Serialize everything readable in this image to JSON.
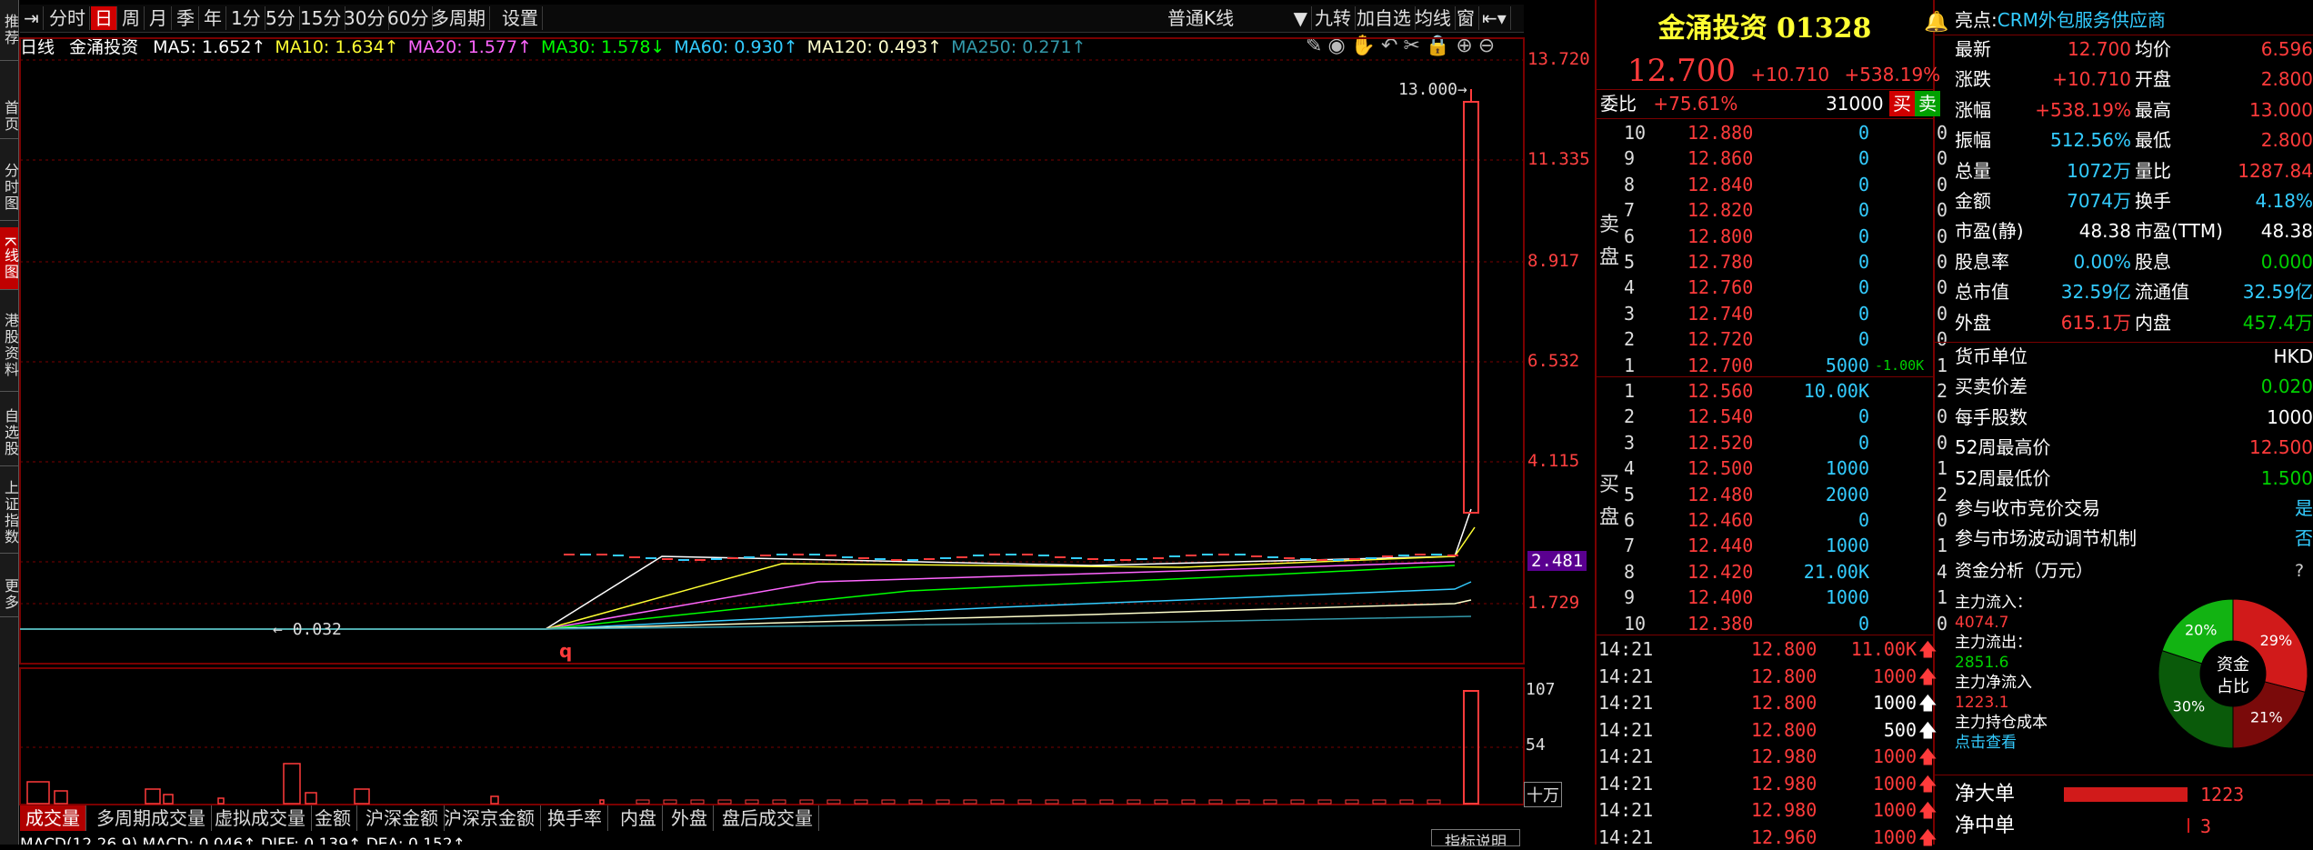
{
  "leftnav": [
    "推荐",
    "首页",
    "分时图",
    "K线图",
    "港股资料",
    "自选股",
    "上证指数",
    "更多"
  ],
  "toolbar": {
    "items": [
      "分时",
      "日",
      "周",
      "月",
      "季",
      "年",
      "1分",
      "5分",
      "15分",
      "30分",
      "60分",
      "多周期",
      "设置"
    ],
    "active": "日",
    "kline_type": "普通K线",
    "right_items": [
      "九转",
      "加自选",
      "均线",
      "窗"
    ]
  },
  "ma_legend": {
    "period": "日线",
    "name": "金涌投资",
    "items": [
      {
        "label": "MA5: 1.652↑",
        "color": "#ffffff"
      },
      {
        "label": "MA10: 1.634↑",
        "color": "#ffff33"
      },
      {
        "label": "MA20: 1.577↑",
        "color": "#ff66ff"
      },
      {
        "label": "MA30: 1.578↓",
        "color": "#00ff00"
      },
      {
        "label": "MA60: 0.930↑",
        "color": "#33ccff"
      },
      {
        "label": "MA120: 0.493↑",
        "color": "#ffffcc"
      },
      {
        "label": "MA250: 0.271↑",
        "color": "#3399aa"
      }
    ]
  },
  "price_axis": [
    "13.720",
    "11.335",
    "8.917",
    "6.532",
    "4.115",
    "2.481",
    "1.729"
  ],
  "annotations": {
    "high": "13.000",
    "low": "0.032",
    "marker": "q"
  },
  "volume_axis": [
    "107",
    "54",
    "十万"
  ],
  "bottom_tabs": [
    "成交量",
    "多周期成交量",
    "虚拟成交量",
    "金额",
    "沪深金额",
    "沪深京金额",
    "换手率",
    "内盘",
    "外盘",
    "盘后成交量"
  ],
  "macd_line": "MACD(12,26,9)  MACD: 0.046↑  DIFF: 0.139↑  DEA: 0.152↑",
  "indicator_btn": "指标说明",
  "stock": {
    "name": "金涌投资 01328",
    "price": "12.700",
    "change": "+10.710",
    "change_pct": "+538.19%"
  },
  "weibi": {
    "label": "委比",
    "value": "+75.61%",
    "amount": "31000",
    "buy": "买",
    "sell": "卖"
  },
  "sell_side_label": "卖盘",
  "buy_side_label": "买盘",
  "sell_orders": [
    {
      "level": "10",
      "price": "12.880",
      "vol": "0",
      "cnt": "0"
    },
    {
      "level": "9",
      "price": "12.860",
      "vol": "0",
      "cnt": "0"
    },
    {
      "level": "8",
      "price": "12.840",
      "vol": "0",
      "cnt": "0"
    },
    {
      "level": "7",
      "price": "12.820",
      "vol": "0",
      "cnt": "0"
    },
    {
      "level": "6",
      "price": "12.800",
      "vol": "0",
      "cnt": "0"
    },
    {
      "level": "5",
      "price": "12.780",
      "vol": "0",
      "cnt": "0"
    },
    {
      "level": "4",
      "price": "12.760",
      "vol": "0",
      "cnt": "0"
    },
    {
      "level": "3",
      "price": "12.740",
      "vol": "0",
      "cnt": "0"
    },
    {
      "level": "2",
      "price": "12.720",
      "vol": "0",
      "cnt": "0"
    },
    {
      "level": "1",
      "price": "12.700",
      "vol": "5000",
      "extra": "-1.00K",
      "cnt": "1"
    }
  ],
  "buy_orders": [
    {
      "level": "1",
      "price": "12.560",
      "vol": "10.00K",
      "cnt": "2"
    },
    {
      "level": "2",
      "price": "12.540",
      "vol": "0",
      "cnt": "0"
    },
    {
      "level": "3",
      "price": "12.520",
      "vol": "0",
      "cnt": "0"
    },
    {
      "level": "4",
      "price": "12.500",
      "vol": "1000",
      "cnt": "1"
    },
    {
      "level": "5",
      "price": "12.480",
      "vol": "2000",
      "cnt": "2"
    },
    {
      "level": "6",
      "price": "12.460",
      "vol": "0",
      "cnt": "0"
    },
    {
      "level": "7",
      "price": "12.440",
      "vol": "1000",
      "cnt": "1"
    },
    {
      "level": "8",
      "price": "12.420",
      "vol": "21.00K",
      "cnt": "4"
    },
    {
      "level": "9",
      "price": "12.400",
      "vol": "1000",
      "cnt": "1"
    },
    {
      "level": "10",
      "price": "12.380",
      "vol": "0",
      "cnt": "0"
    }
  ],
  "ticks": [
    {
      "time": "14:21",
      "price": "12.800",
      "vol": "11.00K",
      "color": "#ff3b3b"
    },
    {
      "time": "14:21",
      "price": "12.800",
      "vol": "1000",
      "color": "#ff3b3b"
    },
    {
      "time": "14:21",
      "price": "12.800",
      "vol": "1000",
      "color": "#ffffff"
    },
    {
      "time": "14:21",
      "price": "12.800",
      "vol": "500",
      "color": "#ffffff"
    },
    {
      "time": "14:21",
      "price": "12.980",
      "vol": "1000",
      "color": "#ff3b3b"
    },
    {
      "time": "14:21",
      "price": "12.980",
      "vol": "1000",
      "color": "#ff3b3b"
    },
    {
      "time": "14:21",
      "price": "12.980",
      "vol": "1000",
      "color": "#ff3b3b"
    },
    {
      "time": "14:21",
      "price": "12.960",
      "vol": "1000",
      "color": "#ff3b3b"
    }
  ],
  "highlight": {
    "label": "亮点:",
    "text": "CRM外包服务供应商"
  },
  "quote_rows": [
    {
      "l1": "最新",
      "v1": "12.700",
      "c1": "#ff3b3b",
      "l2": "均价",
      "v2": "6.596",
      "c2": "#ff3b3b"
    },
    {
      "l1": "涨跌",
      "v1": "+10.710",
      "c1": "#ff3b3b",
      "l2": "开盘",
      "v2": "2.800",
      "c2": "#ff3b3b"
    },
    {
      "l1": "涨幅",
      "v1": "+538.19%",
      "c1": "#ff3b3b",
      "l2": "最高",
      "v2": "13.000",
      "c2": "#ff3b3b"
    },
    {
      "l1": "振幅",
      "v1": "512.56%",
      "c1": "#33ccff",
      "l2": "最低",
      "v2": "2.800",
      "c2": "#ff3b3b"
    },
    {
      "l1": "总量",
      "v1": "1072万",
      "c1": "#33ccff",
      "l2": "量比",
      "v2": "1287.84",
      "c2": "#ff3b3b"
    },
    {
      "l1": "金额",
      "v1": "7074万",
      "c1": "#33ccff",
      "l2": "换手",
      "v2": "4.18%",
      "c2": "#33ccff"
    },
    {
      "l1": "市盈(静)",
      "v1": "48.38",
      "c1": "#ffffff",
      "l2": "市盈(TTM)",
      "v2": "48.38",
      "c2": "#ffffff"
    },
    {
      "l1": "股息率",
      "v1": "0.00%",
      "c1": "#33ccff",
      "l2": "股息",
      "v2": "0.000",
      "c2": "#00d000"
    },
    {
      "l1": "总市值",
      "v1": "32.59亿",
      "c1": "#33ccff",
      "l2": "流通值",
      "v2": "32.59亿",
      "c2": "#33ccff"
    },
    {
      "l1": "外盘",
      "v1": "615.1万",
      "c1": "#ff3b3b",
      "l2": "内盘",
      "v2": "457.4万",
      "c2": "#00d000"
    }
  ],
  "info_rows": [
    {
      "label": "货币单位",
      "value": "HKD",
      "color": "#ffffff"
    },
    {
      "label": "买卖价差",
      "value": "0.020",
      "color": "#00d000"
    },
    {
      "label": "每手股数",
      "value": "1000",
      "color": "#ffffff"
    },
    {
      "label": "52周最高价",
      "value": "12.500",
      "color": "#ff3b3b"
    },
    {
      "label": "52周最低价",
      "value": "1.500",
      "color": "#00d000"
    },
    {
      "label": "参与收市竞价交易",
      "value": "是",
      "color": "#33ccff"
    },
    {
      "label": "参与市场波动调节机制",
      "value": "否",
      "color": "#33ccff"
    }
  ],
  "fund": {
    "title": "资金分析（万元）",
    "help": "?",
    "inflow_label": "主力流入：",
    "inflow": "4074.7",
    "outflow_label": "主力流出：",
    "outflow": "2851.6",
    "net_label": "主力净流入",
    "net": "1223.1",
    "cost_label": "主力持仓成本",
    "link": "点击查看",
    "pie_center": "资金\n占比",
    "pie_center_1": "资金",
    "pie_center_2": "占比",
    "slices": [
      {
        "label": "29%",
        "value": 29,
        "color": "#d11a1a"
      },
      {
        "label": "21%",
        "value": 21,
        "color": "#7a0a0a"
      },
      {
        "label": "30%",
        "value": 30,
        "color": "#0a5a0a"
      },
      {
        "label": "20%",
        "value": 20,
        "color": "#12b312"
      }
    ]
  },
  "net_big": {
    "label": "净大单",
    "value": "1223"
  },
  "net_mid": {
    "label": "净中单",
    "value": "3"
  },
  "colors": {
    "up": "#ff3b3b",
    "down": "#00d000",
    "accent": "#d00000",
    "grid": "#7a0000"
  }
}
